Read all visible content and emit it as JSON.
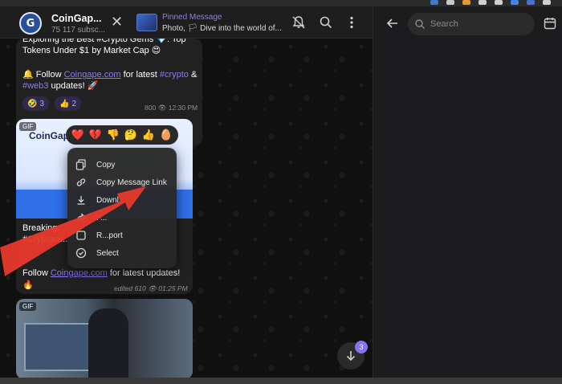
{
  "header": {
    "channel_title": "CoinGap...",
    "channel_subtitle": "75 117 subsc...",
    "pinned_label": "Pinned Message",
    "pinned_text": "Photo, 🏳 Dive into the world of...",
    "avatar_letter": "G"
  },
  "messages": [
    {
      "line1": "Exploring the Best #Crypto Gems 💎: Top",
      "line2": "Tokens Under $1 by Market Cap 😍",
      "line3_prefix": "🔔 Follow ",
      "line3_link": "Coingape.com",
      "line3_mid": " for latest ",
      "line3_tag": "#crypto",
      "line3_suffix": " &",
      "line4_tag": "#web3",
      "line4_suffix": " updates! 🚀",
      "reactions": [
        {
          "emoji": "🤣",
          "count": "3"
        },
        {
          "emoji": "👍",
          "count": "2"
        }
      ],
      "views": "800",
      "time": "12:30 PM"
    },
    {
      "gif_label": "GIF",
      "gif_logo": "CoinGap",
      "text1": "Breaking: ",
      "text2": "#Cryptocu...",
      "follow_prefix": "Follow ",
      "follow_link": "Coingape.com",
      "follow_suffix": " for latest updates!",
      "fire": "🔥",
      "edited": "edited",
      "views": "610",
      "time": "01:25 PM"
    },
    {
      "gif_label": "GIF"
    }
  ],
  "reaction_bar": [
    "❤️",
    "💔",
    "👎",
    "🤔",
    "👍",
    "🥚"
  ],
  "context_menu": {
    "items": [
      {
        "label": "Copy",
        "icon": "copy-icon"
      },
      {
        "label": "Copy Message Link",
        "icon": "link-icon"
      },
      {
        "label": "Downl...",
        "icon": "download-icon"
      },
      {
        "label": "F...",
        "icon": "forward-icon"
      },
      {
        "label": "R...port",
        "icon": "report-icon"
      },
      {
        "label": "Select",
        "icon": "select-icon"
      }
    ]
  },
  "scroll_badge": "3",
  "sidebar": {
    "search_placeholder": "Search"
  },
  "colors": {
    "accent": "#8a7cf0",
    "arrow": "#e8392c",
    "bubble": "#212121"
  }
}
